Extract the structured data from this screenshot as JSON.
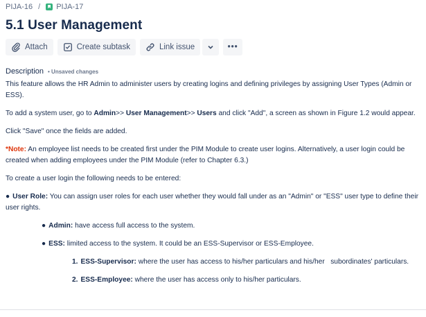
{
  "breadcrumb": {
    "parent": "PIJA-16",
    "separator": "/",
    "current": "PIJA-17"
  },
  "issue": {
    "title": "5.1 User Management"
  },
  "toolbar": {
    "attach_label": "Attach",
    "create_subtask_label": "Create subtask",
    "link_issue_label": "Link issue",
    "more_label": "•••"
  },
  "description": {
    "label": "Description",
    "unsaved": "• Unsaved changes",
    "p1": "This feature allows the HR Admin to administer users by creating logins and defining privileges by assigning User Types (Admin or ESS).",
    "p2_a": "To add a system user, go to ",
    "p2_b": "Admin",
    "p2_c": ">> ",
    "p2_d": "User Management",
    "p2_e": ">> ",
    "p2_f": "Users",
    "p2_g": " and click \"Add\", a screen as shown in Figure 1.2 would appear.",
    "p3": "Click \"Save\" once the fields are added.",
    "note_label": "*Note:",
    "note_text": " An employee list needs to be created first under the PIM Module to create user logins. Alternatively, a user login could be created when adding employees under the PIM Module (refer to Chapter 6.3.)",
    "p5": "To create a user login the following needs to be entered:",
    "role_bullet": "●",
    "role_label": "User Role:",
    "role_text": " You can assign user roles for each user whether they would fall under as an \"Admin\" or \"ESS\" user type to define their user rights.",
    "admin_label": "Admin:",
    "admin_text": " have access full access to the system.",
    "ess_label": "ESS:",
    "ess_text": " limited access to the system. It could be an ESS-Supervisor or ESS-Employee.",
    "sup_num": "1.",
    "sup_label": "ESS-Supervisor:",
    "sup_text": " where the user has access to his/her particulars and his/her   subordinates' particulars.",
    "emp_num": "2.",
    "emp_label": "ESS-Employee:",
    "emp_text": " where the user has access only to his/her particulars."
  },
  "colors": {
    "text": "#172b4d",
    "muted": "#5e6c84",
    "note": "#de350b",
    "button_bg": "#f4f5f7",
    "story_icon": "#36b37e"
  }
}
